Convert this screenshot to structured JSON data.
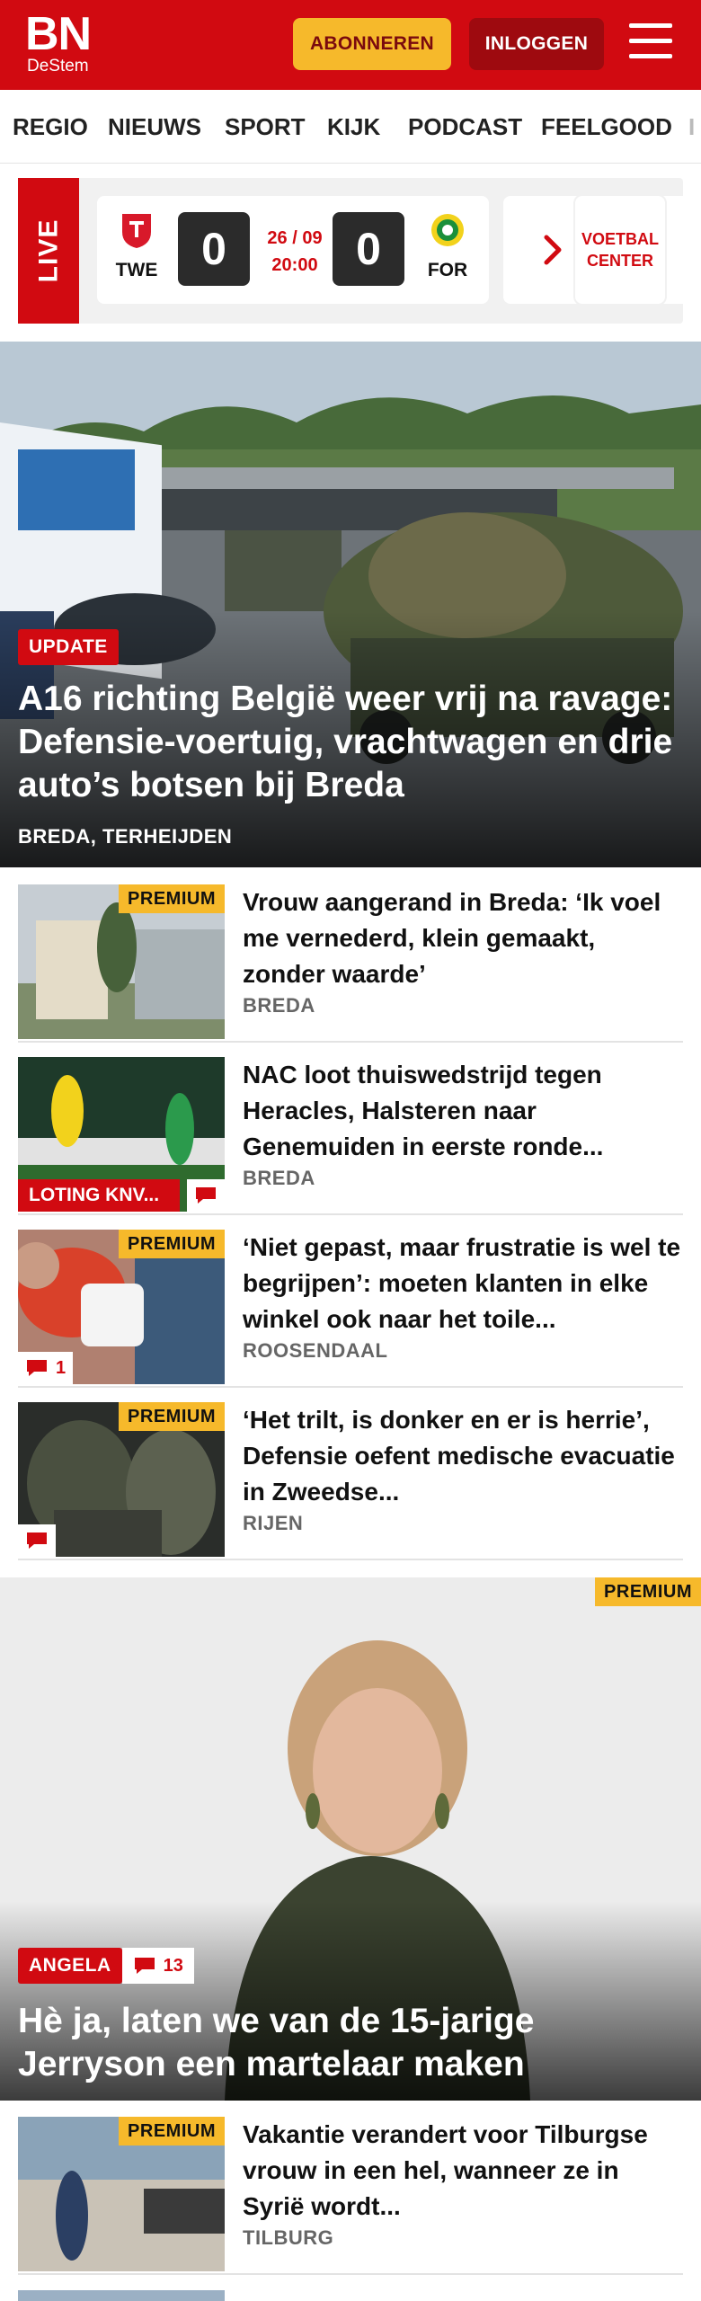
{
  "header": {
    "logo_main": "BN",
    "logo_sub": "DeStem",
    "subscribe_label": "ABONNEREN",
    "login_label": "INLOGGEN",
    "brand_color": "#d10a11",
    "subscribe_color": "#f6b92b"
  },
  "nav": {
    "items": [
      "REGIO",
      "NIEUWS",
      "SPORT",
      "KIJK",
      "PODCAST",
      "FEELGOOD",
      "I"
    ]
  },
  "live": {
    "tab_label": "LIVE",
    "match": {
      "home_abbr": "TWE",
      "away_abbr": "FOR",
      "home_score": "0",
      "away_score": "0",
      "date": "26 / 09",
      "time": "20:00"
    },
    "voetbal_center_label": "VOETBAL CENTER"
  },
  "hero": {
    "label": "UPDATE",
    "title": "A16 richting België weer vrij na ravage: Defensie-voertuig, vrachtwa­gen en drie auto’s botsen bij Breda",
    "location": "BREDA, TERHEIJDEN"
  },
  "articles": [
    {
      "premium": "PREMIUM",
      "title": "Vrouw aangerand in Breda: ‘Ik voel me vernederd, klein gemaakt, zonder waarde’",
      "location": "BREDA"
    },
    {
      "tag": "LOTING KNV...",
      "title": "NAC loot thuiswedstrijd tegen Heracles, Halsteren naar Genemuiden in eerste ronde...",
      "location": "BREDA"
    },
    {
      "premium": "PREMIUM",
      "comments": "1",
      "title": "‘Niet gepast, maar frustratie is wel te begrijpen’: moeten klanten in elke winkel ook naar het toile...",
      "location": "ROOSENDAAL"
    },
    {
      "premium": "PREMIUM",
      "title": "‘Het trilt, is donker en er is herrie’, Defensie oefent medische evacuatie in Zweedse...",
      "location": "RIJEN"
    }
  ],
  "feature": {
    "premium": "PREMIUM",
    "label": "ANGELA",
    "comments": "13",
    "title": "Hè ja, laten we van de 15-jarige Jerryson een martelaar maken"
  },
  "article_last": {
    "premium": "PREMIUM",
    "title": "Vakantie verandert voor Tilburgse vrouw in een hel, wanneer ze in Syrië wordt...",
    "location": "TILBURG"
  }
}
